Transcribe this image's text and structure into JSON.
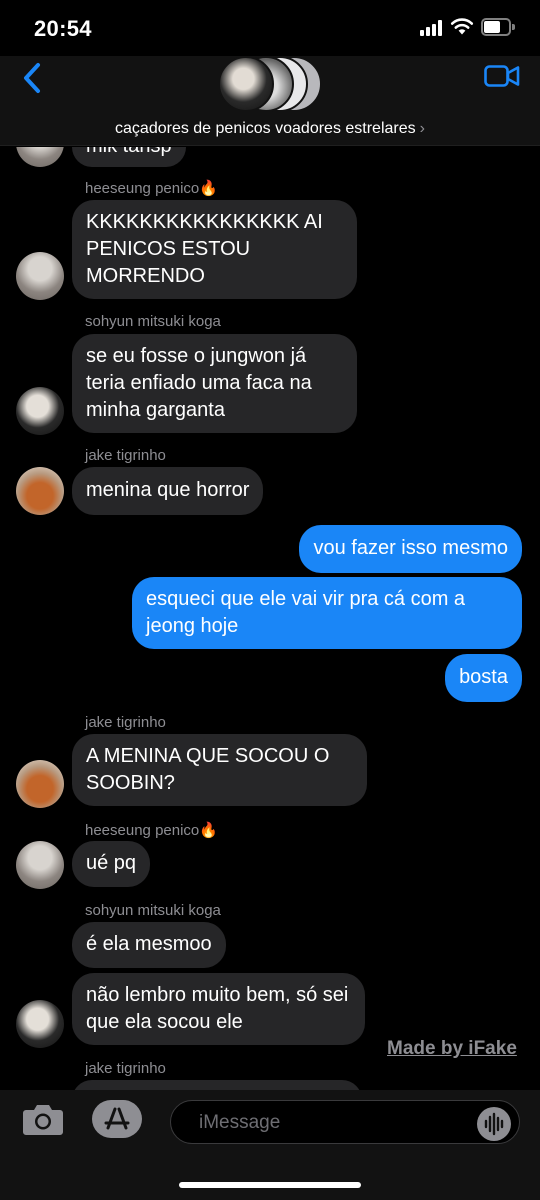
{
  "status_bar": {
    "time": "20:54"
  },
  "header": {
    "group_name": "caçadores de penicos voadores estrelares",
    "group_chevron": "›"
  },
  "messages": [
    {
      "type": "incoming",
      "text": "mik tansp"
    },
    {
      "type": "incoming",
      "sender": "heeseung penico🔥",
      "text": "KKKKKKKKKKKKKKKK AI PENICOS ESTOU MORRENDO"
    },
    {
      "type": "incoming",
      "sender": "sohyun mitsuki koga",
      "text": "se eu fosse o jungwon já teria enfiado uma faca na minha garganta"
    },
    {
      "type": "incoming",
      "sender": "jake tigrinho",
      "text": "menina que horror"
    },
    {
      "type": "outgoing",
      "text": "vou fazer isso mesmo"
    },
    {
      "type": "outgoing",
      "text": "esqueci que ele vai vir pra cá com a jeong hoje"
    },
    {
      "type": "outgoing",
      "text": "bosta"
    },
    {
      "type": "incoming",
      "sender": "jake tigrinho",
      "text": "A MENINA QUE SOCOU O SOOBIN?"
    },
    {
      "type": "incoming",
      "sender": "heeseung penico🔥",
      "text": "ué pq"
    },
    {
      "type": "incoming",
      "sender": "sohyun mitsuki koga",
      "text": "é ela mesmoo"
    },
    {
      "type": "incoming",
      "text": "não lembro muito bem, só sei que ela socou ele"
    },
    {
      "type": "incoming",
      "sender": "jake tigrinho",
      "text": ""
    }
  ],
  "watermark": "Made by iFake",
  "input": {
    "placeholder": "iMessage"
  },
  "icons": {
    "back": "chevron-left-icon",
    "video": "video-camera-icon",
    "camera": "camera-icon",
    "app_store": "app-store-icon",
    "audio": "audio-waveform-icon"
  },
  "colors": {
    "accent": "#1a86f7",
    "incoming_bubble": "#262628",
    "background": "#000000"
  }
}
